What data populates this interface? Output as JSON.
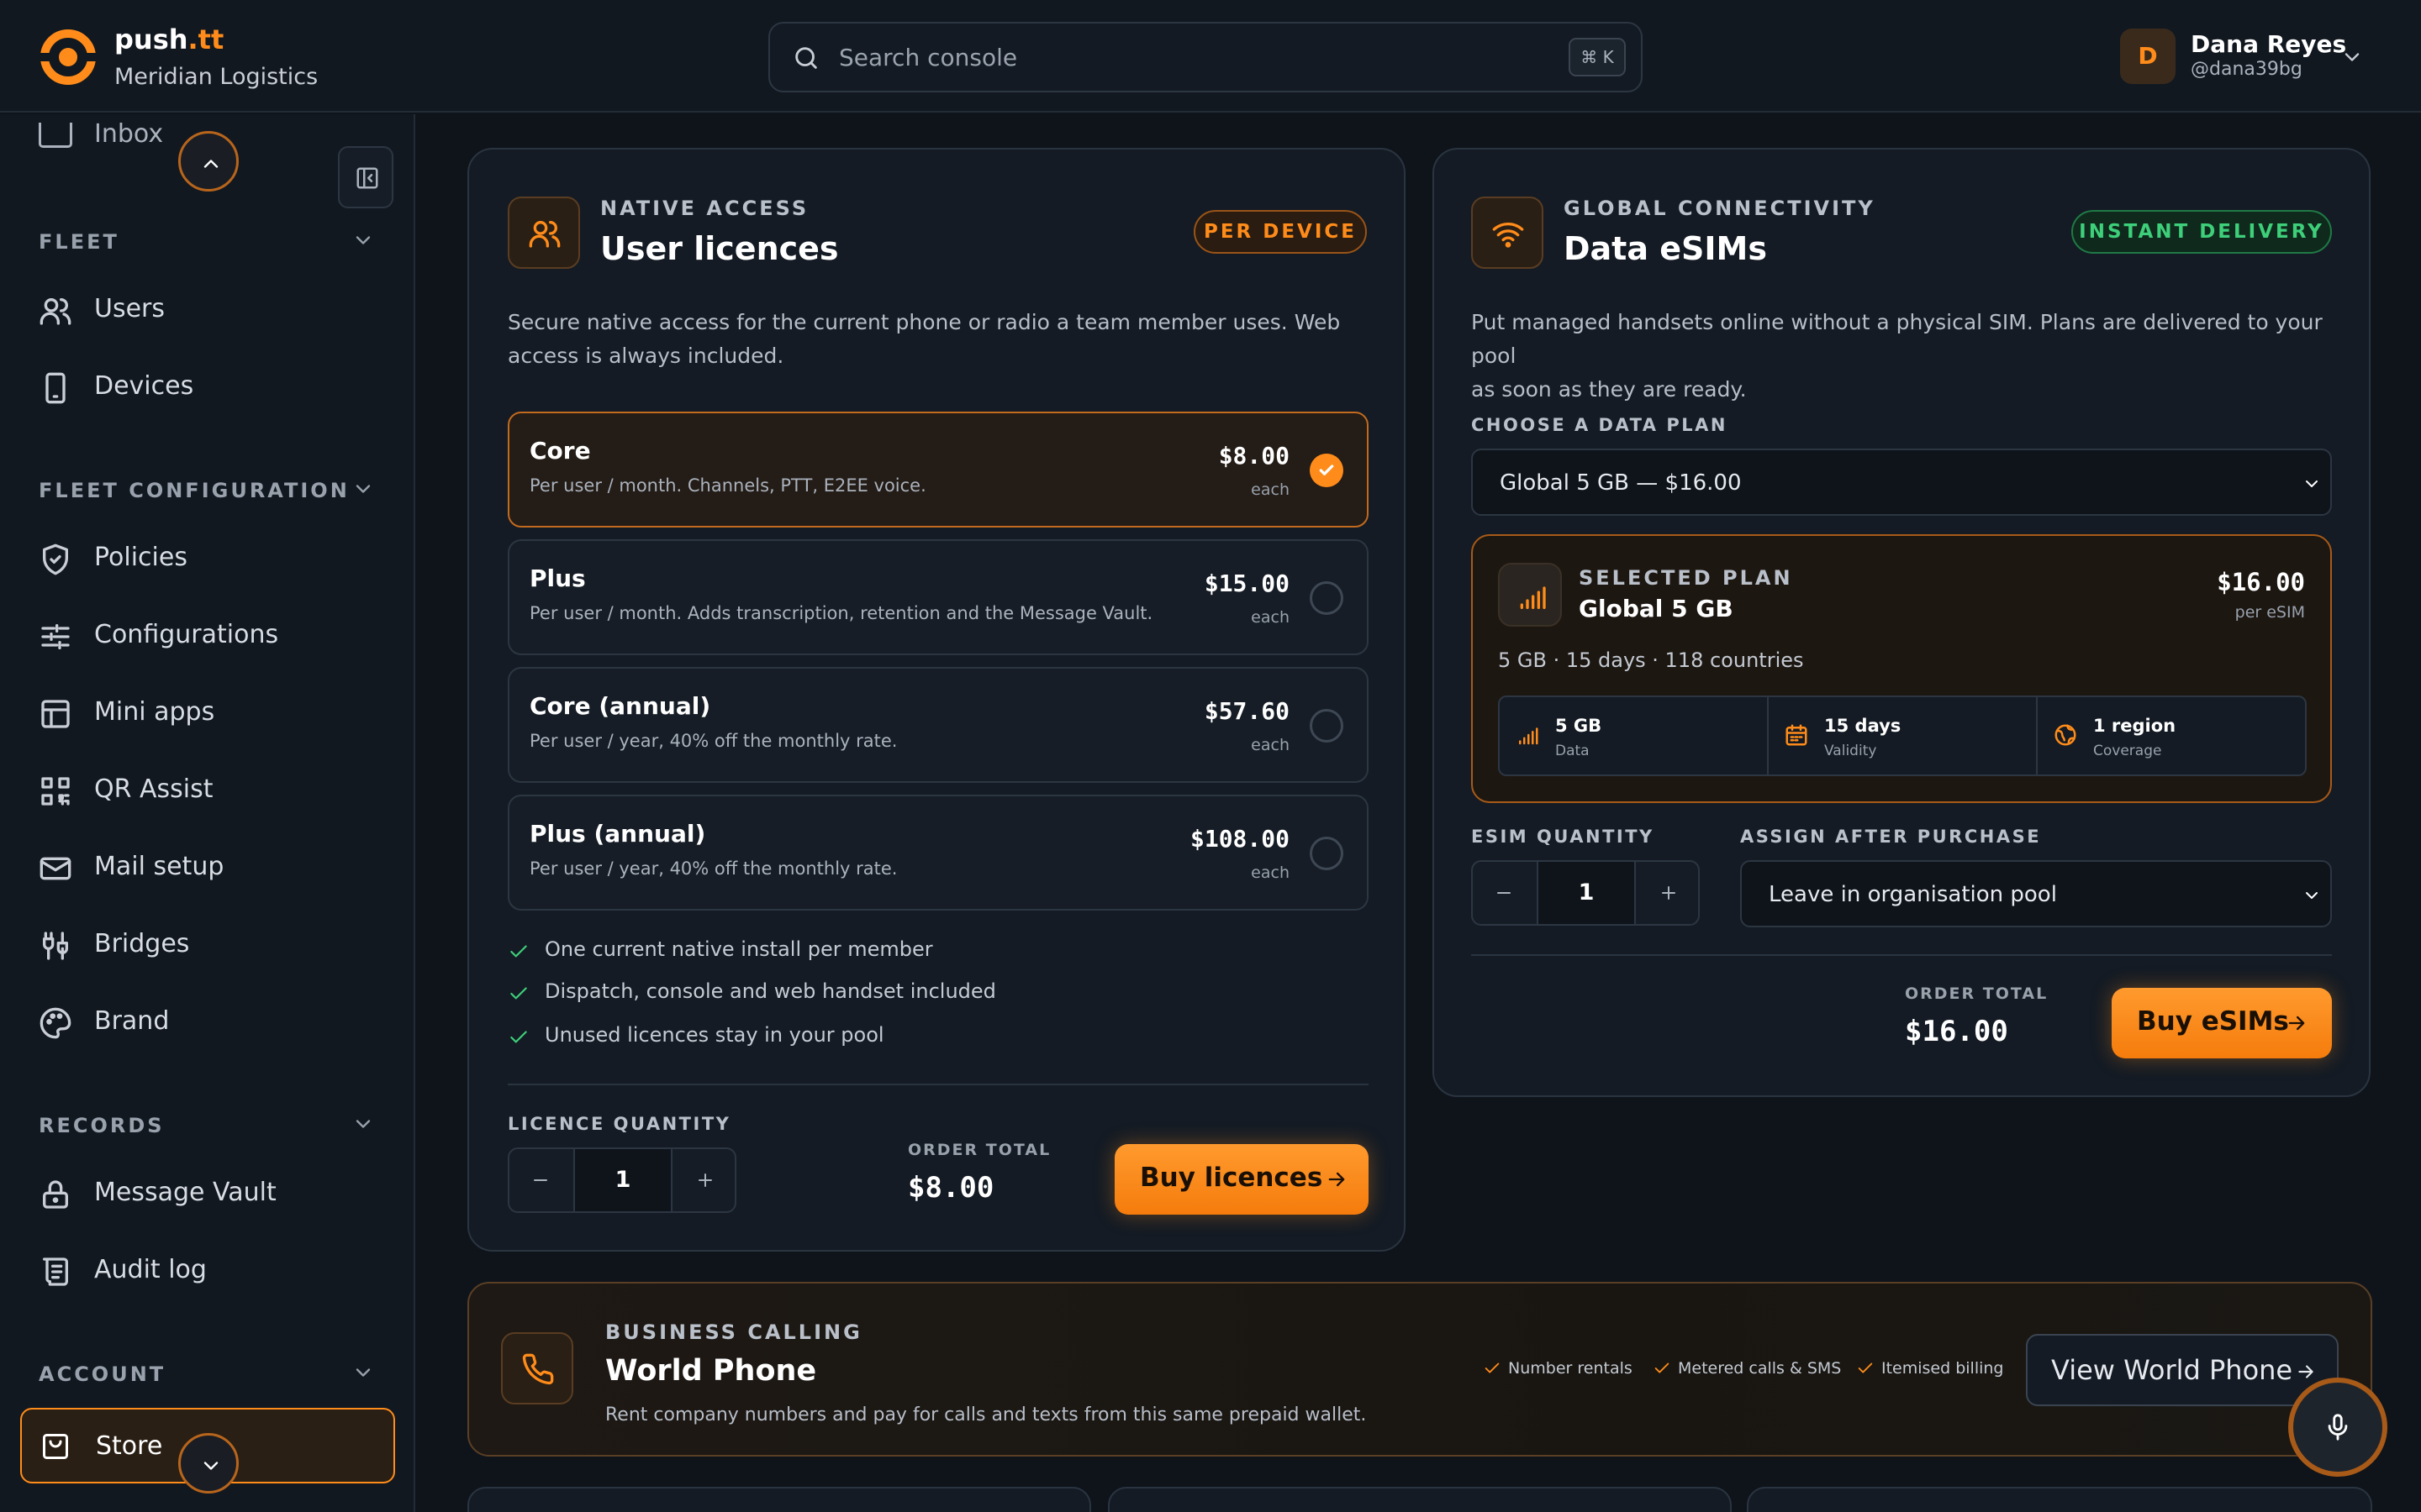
{
  "header": {
    "brand_prefix": "push",
    "brand_suffix": ".tt",
    "org": "Meridian Logistics",
    "search_placeholder": "Search console",
    "search_shortcut": "⌘ K",
    "user": {
      "initial": "D",
      "name": "Dana Reyes",
      "handle": "@dana39bg"
    }
  },
  "sidebar": {
    "partial_item": "Inbox",
    "sections": [
      {
        "title": "FLEET",
        "items": [
          {
            "label": "Users",
            "icon": "users-icon"
          },
          {
            "label": "Devices",
            "icon": "device-icon"
          }
        ]
      },
      {
        "title": "FLEET CONFIGURATION",
        "items": [
          {
            "label": "Policies",
            "icon": "shield-icon"
          },
          {
            "label": "Configurations",
            "icon": "sliders-icon"
          },
          {
            "label": "Mini apps",
            "icon": "layout-icon"
          },
          {
            "label": "QR Assist",
            "icon": "qr-icon"
          },
          {
            "label": "Mail setup",
            "icon": "mail-icon"
          },
          {
            "label": "Bridges",
            "icon": "bridge-icon"
          },
          {
            "label": "Brand",
            "icon": "palette-icon"
          }
        ]
      },
      {
        "title": "RECORDS",
        "items": [
          {
            "label": "Message Vault",
            "icon": "lock-icon"
          },
          {
            "label": "Audit log",
            "icon": "scroll-icon"
          }
        ]
      },
      {
        "title": "ACCOUNT",
        "items": [
          {
            "label": "Store",
            "icon": "bag-icon",
            "active": true
          }
        ]
      }
    ]
  },
  "licences": {
    "eyebrow": "NATIVE ACCESS",
    "title": "User licences",
    "badge": "PER DEVICE",
    "description_line1": "Secure native access for the current phone or radio a team member uses. Web",
    "description_line2": "access is always included.",
    "plans": [
      {
        "name": "Core",
        "desc": "Per user / month. Channels, PTT, E2EE voice.",
        "price": "$8.00",
        "unit": "each",
        "selected": true
      },
      {
        "name": "Plus",
        "desc": "Per user / month. Adds transcription, retention and the Message Vault.",
        "price": "$15.00",
        "unit": "each",
        "selected": false
      },
      {
        "name": "Core (annual)",
        "desc": "Per user / year, 40% off the monthly rate.",
        "price": "$57.60",
        "unit": "each",
        "selected": false
      },
      {
        "name": "Plus (annual)",
        "desc": "Per user / year, 40% off the monthly rate.",
        "price": "$108.00",
        "unit": "each",
        "selected": false
      }
    ],
    "features": [
      "One current native install per member",
      "Dispatch, console and web handset included",
      "Unused licences stay in your pool"
    ],
    "quantity_label": "LICENCE QUANTITY",
    "quantity": "1",
    "total_label": "ORDER TOTAL",
    "total": "$8.00",
    "buy_label": "Buy licences"
  },
  "esims": {
    "eyebrow": "GLOBAL CONNECTIVITY",
    "title": "Data eSIMs",
    "badge": "INSTANT DELIVERY",
    "description_line1": "Put managed handsets online without a physical SIM. Plans are delivered to your pool",
    "description_line2": "as soon as they are ready.",
    "plan_label": "CHOOSE A DATA PLAN",
    "plan_value": "Global 5 GB — $16.00",
    "selected": {
      "eyebrow": "SELECTED PLAN",
      "name": "Global 5 GB",
      "price": "$16.00",
      "unit": "per eSIM",
      "summary": "5 GB · 15 days · 118 countries",
      "stats": [
        {
          "value": "5 GB",
          "label": "Data",
          "icon": "signal-icon"
        },
        {
          "value": "15 days",
          "label": "Validity",
          "icon": "calendar-icon"
        },
        {
          "value": "1 region",
          "label": "Coverage",
          "icon": "globe-icon"
        }
      ]
    },
    "quantity_label": "ESIM QUANTITY",
    "quantity": "1",
    "assign_label": "ASSIGN AFTER PURCHASE",
    "assign_value": "Leave in organisation pool",
    "total_label": "ORDER TOTAL",
    "total": "$16.00",
    "buy_label": "Buy eSIMs"
  },
  "world_phone": {
    "eyebrow": "BUSINESS CALLING",
    "title": "World Phone",
    "description": "Rent company numbers and pay for calls and texts from this same prepaid wallet.",
    "features": [
      "Number rentals",
      "Metered calls & SMS",
      "Itemised billing"
    ],
    "button": "View World Phone"
  },
  "colors": {
    "accent": "#ff8c1a",
    "success": "#3ecf7a",
    "background": "#0f141b"
  }
}
